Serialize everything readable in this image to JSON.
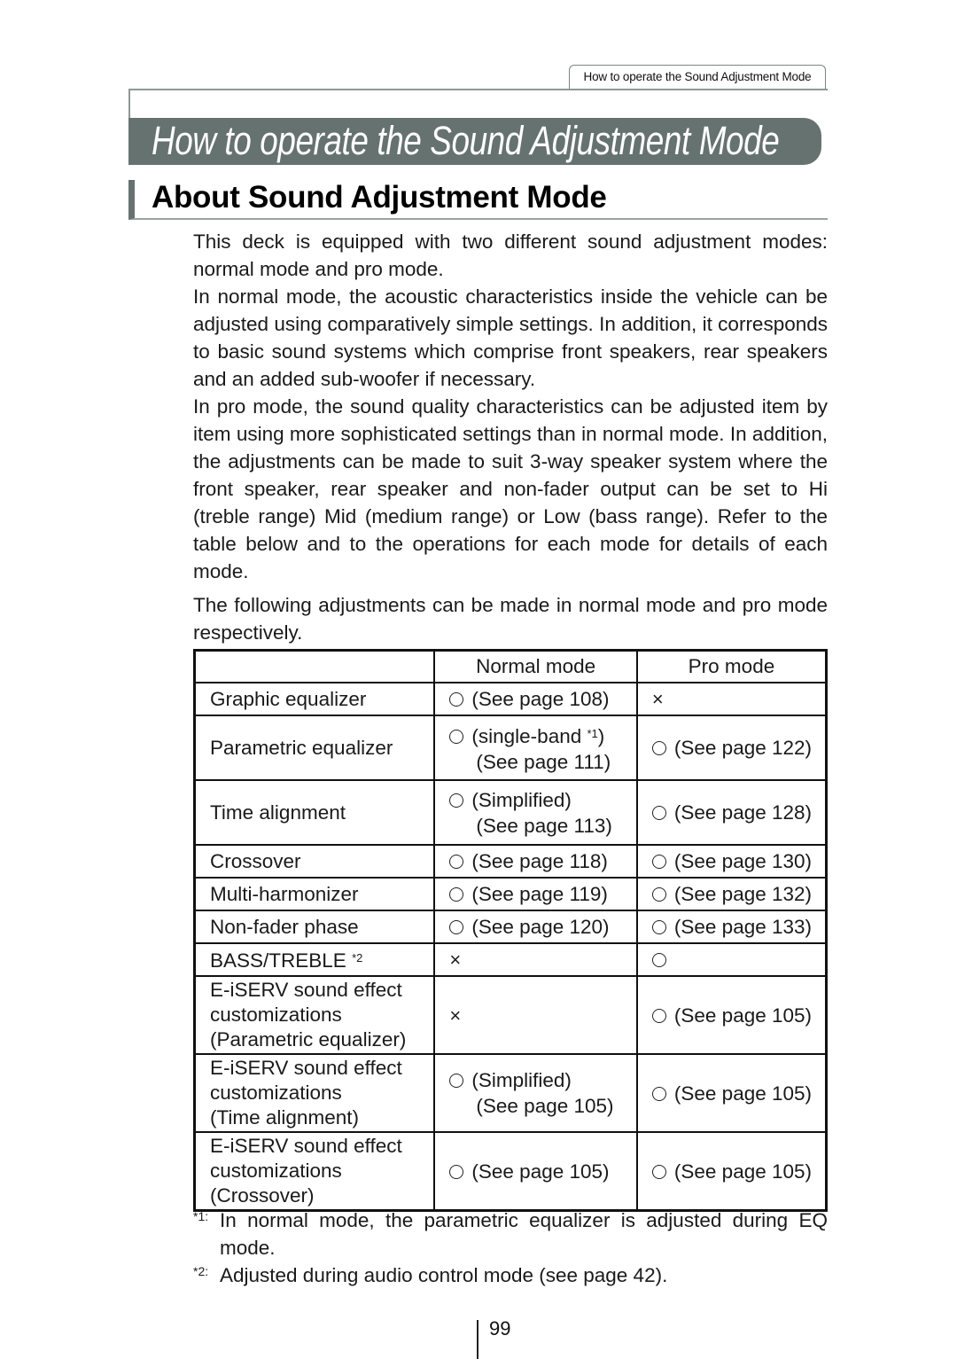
{
  "running_header": "How to operate the Sound Adjustment Mode",
  "chapter_title": "How to operate the Sound Adjustment Mode",
  "section_title": "About Sound Adjustment Mode",
  "paragraphs": [
    "This deck is equipped with two different sound adjustment modes: normal mode and pro mode.",
    "In normal mode, the acoustic characteristics inside the vehicle can be adjusted using comparatively simple settings. In addition, it corresponds to basic sound systems which comprise front speakers, rear speakers and an added sub-woofer if necessary.",
    "In pro mode, the sound quality characteristics can be adjusted item by item using more sophisticated settings than in normal mode. In addition, the adjustments can be made to suit 3-way speaker system where the front speaker, rear speaker and non-fader output can be set to Hi (treble range) Mid (medium range) or Low (bass range). Refer to the table below and to the operations for each mode for details of each mode.",
    "The following adjustments can be made in normal mode and pro mode respectively."
  ],
  "table": {
    "headers": [
      "",
      "Normal mode",
      "Pro mode"
    ],
    "rows": [
      {
        "feature": [
          "Graphic equalizer"
        ],
        "feature_sup": "",
        "normal": {
          "mark": "circle",
          "lines": [
            "(See page 108)"
          ],
          "sup": ""
        },
        "pro": {
          "mark": "cross",
          "lines": [
            ""
          ]
        }
      },
      {
        "feature": [
          "Parametric equalizer"
        ],
        "feature_sup": "",
        "normal": {
          "mark": "circle",
          "lines": [
            "(single-band ",
            "(See page 111)"
          ],
          "sup": "*1",
          "after_sup": ")"
        },
        "pro": {
          "mark": "circle",
          "lines": [
            "(See page 122)"
          ]
        }
      },
      {
        "feature": [
          "Time alignment"
        ],
        "feature_sup": "",
        "normal": {
          "mark": "circle",
          "lines": [
            "(Simplified)",
            "(See page 113)"
          ]
        },
        "pro": {
          "mark": "circle",
          "lines": [
            "(See page 128)"
          ]
        }
      },
      {
        "feature": [
          "Crossover"
        ],
        "feature_sup": "",
        "normal": {
          "mark": "circle",
          "lines": [
            "(See page 118)"
          ]
        },
        "pro": {
          "mark": "circle",
          "lines": [
            "(See page 130)"
          ]
        }
      },
      {
        "feature": [
          "Multi-harmonizer"
        ],
        "feature_sup": "",
        "normal": {
          "mark": "circle",
          "lines": [
            "(See page 119)"
          ]
        },
        "pro": {
          "mark": "circle",
          "lines": [
            "(See page 132)"
          ]
        }
      },
      {
        "feature": [
          "Non-fader phase"
        ],
        "feature_sup": "",
        "normal": {
          "mark": "circle",
          "lines": [
            "(See page 120)"
          ]
        },
        "pro": {
          "mark": "circle",
          "lines": [
            "(See page 133)"
          ]
        }
      },
      {
        "feature": [
          "BASS/TREBLE "
        ],
        "feature_sup": "*2",
        "normal": {
          "mark": "cross",
          "lines": [
            ""
          ]
        },
        "pro": {
          "mark": "circle",
          "lines": [
            ""
          ]
        }
      },
      {
        "feature": [
          "E-iSERV sound effect",
          "customizations",
          "(Parametric equalizer)"
        ],
        "feature_sup": "",
        "normal": {
          "mark": "cross",
          "lines": [
            ""
          ]
        },
        "pro": {
          "mark": "circle",
          "lines": [
            "(See page 105)"
          ]
        }
      },
      {
        "feature": [
          "E-iSERV sound effect",
          "customizations",
          "(Time alignment)"
        ],
        "feature_sup": "",
        "normal": {
          "mark": "circle",
          "lines": [
            "(Simplified)",
            "(See page 105)"
          ]
        },
        "pro": {
          "mark": "circle",
          "lines": [
            "(See page 105)"
          ]
        }
      },
      {
        "feature": [
          "E-iSERV sound effect",
          "customizations",
          "(Crossover)"
        ],
        "feature_sup": "",
        "normal": {
          "mark": "circle",
          "lines": [
            "(See page 105)"
          ]
        },
        "pro": {
          "mark": "circle",
          "lines": [
            "(See page 105)"
          ]
        }
      }
    ]
  },
  "footnotes": [
    {
      "mark": "*1:",
      "text": "In normal mode, the parametric equalizer is adjusted during EQ mode."
    },
    {
      "mark": "*2:",
      "text": "Adjusted during audio control mode (see page 42)."
    }
  ],
  "page_number": "99",
  "colors": {
    "accent": "#66726f",
    "rule": "#8e9896"
  }
}
